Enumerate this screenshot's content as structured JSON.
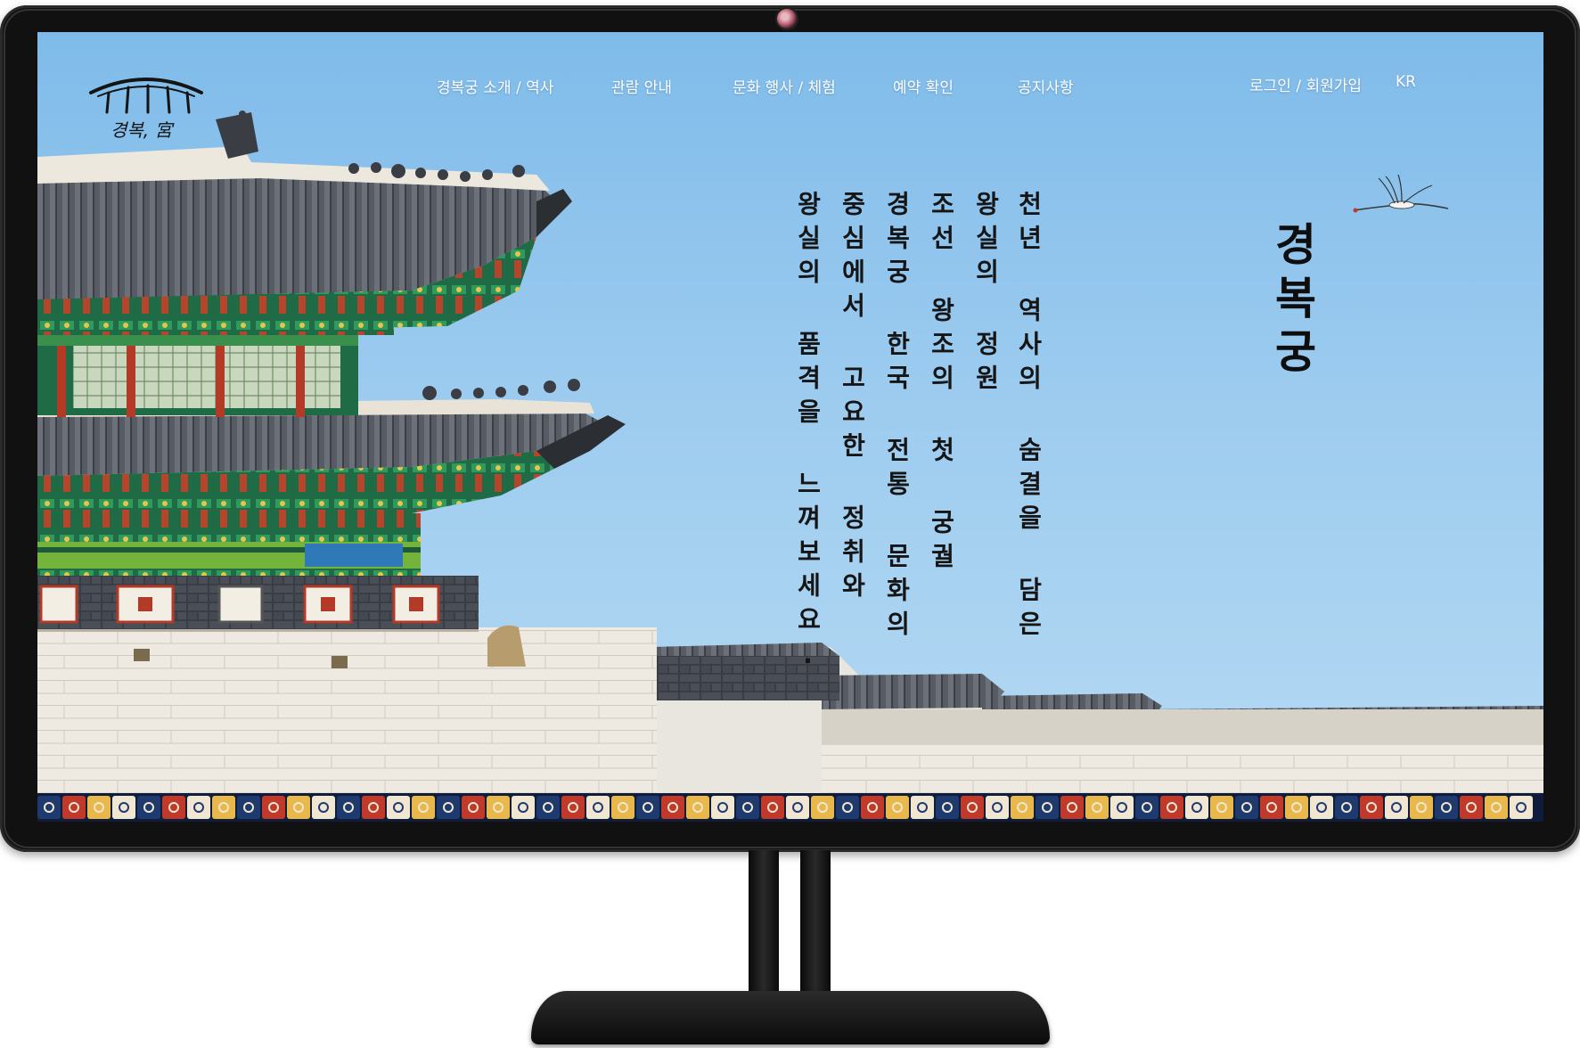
{
  "site": {
    "logo": {
      "icon": "palace-roof-logo-icon",
      "text": "경복, 宮"
    }
  },
  "nav": {
    "items": [
      {
        "label": "경복궁 소개 / 역사"
      },
      {
        "label": "관람 안내"
      },
      {
        "label": "문화 행사 / 체험"
      },
      {
        "label": "예약 확인"
      },
      {
        "label": "공지사항"
      }
    ],
    "login_label": "로그인 / 회원가입",
    "language_label": "KR"
  },
  "hero": {
    "title": "경복궁",
    "lines": [
      "천년 역사의 숨결을 담은",
      "왕실의 정원",
      "조선 왕조의 첫 궁궐",
      "경복궁 한국 전통 문화의",
      "중심에서 고요한 정취와",
      "왕실의 품격을 느껴보세요."
    ],
    "decoration_icon": "crane-icon"
  },
  "colors": {
    "sky": "#9ccbef",
    "nav_text": "#ffffff",
    "hero_text": "#151515",
    "pattern": [
      "#1f3a6e",
      "#c0392b",
      "#e8b84a",
      "#f0e6d2",
      "#2c2c2c"
    ]
  }
}
